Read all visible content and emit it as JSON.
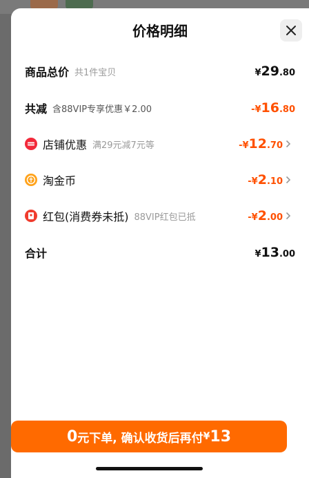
{
  "sheet": {
    "title": "价格明细"
  },
  "goods_total": {
    "label": "商品总价",
    "sub": "共1件宝贝",
    "currency": "¥",
    "int": "29",
    "dec": ".80"
  },
  "total_reduction": {
    "label": "共减",
    "sub": "含88VIP专享优惠￥2.00",
    "prefix": "-¥",
    "int": "16",
    "dec": ".80"
  },
  "store_discount": {
    "label": "店铺优惠",
    "sub": "满29元减7元等",
    "prefix": "-¥",
    "int": "12",
    "dec": ".70"
  },
  "taojinbi": {
    "label": "淘金币",
    "prefix": "-¥",
    "int": "2",
    "dec": ".10"
  },
  "red_packet": {
    "label": "红包(消费券未抵)",
    "sub": "88VIP红包已抵",
    "prefix": "-¥",
    "int": "2",
    "dec": ".00"
  },
  "total": {
    "label": "合计",
    "currency": "¥",
    "int": "13",
    "dec": ".00"
  },
  "cta": {
    "lead_num": "0",
    "text": "元下单, 确认收货后再付",
    "currency": "¥",
    "amount": "13"
  },
  "colors": {
    "accent": "#ff5000",
    "button": "#ff6a00",
    "store_icon": "#f2293a",
    "coin_icon": "#ffa21a",
    "packet_icon": "#f03c2e"
  },
  "icons": {
    "close": "close-icon",
    "store": "store-discount-icon",
    "coin": "coin-icon",
    "packet": "red-packet-icon",
    "chevron": "chevron-right-icon"
  }
}
